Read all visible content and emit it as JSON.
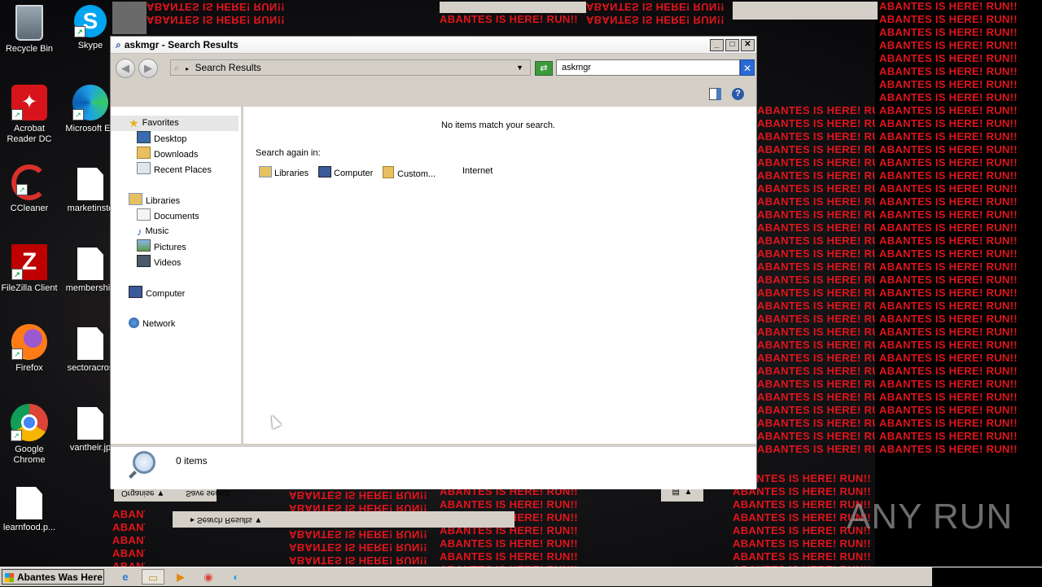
{
  "spam_text": "ABANTES IS HERE! RUN!!",
  "desktop_icons": [
    {
      "label": "Recycle Bin"
    },
    {
      "label": "Skype"
    },
    {
      "label": "Acrobat Reader DC"
    },
    {
      "label": "Microsoft Ed"
    },
    {
      "label": "CCleaner"
    },
    {
      "label": "marketinste"
    },
    {
      "label": "FileZilla Client"
    },
    {
      "label": "membership"
    },
    {
      "label": "Firefox"
    },
    {
      "label": "sectoracros"
    },
    {
      "label": "Google Chrome"
    },
    {
      "label": "vantheir.jp"
    },
    {
      "label": "learnfood.p..."
    }
  ],
  "window": {
    "title": "askmgr - Search Results",
    "address": "Search Results",
    "search_value": "askmgr",
    "nav": {
      "favorites": "Favorites",
      "desktop": "Desktop",
      "downloads": "Downloads",
      "recent": "Recent Places",
      "libraries": "Libraries",
      "documents": "Documents",
      "music": "Music",
      "pictures": "Pictures",
      "videos": "Videos",
      "computer": "Computer",
      "network": "Network"
    },
    "content": {
      "empty_message": "No items match your search.",
      "search_again": "Search again in:",
      "locations": [
        "Libraries",
        "Computer",
        "Custom...",
        "Internet"
      ]
    },
    "status_count": "0 items"
  },
  "ghost": {
    "organise": "Organise",
    "save_search": "Save search",
    "breadcrumb": "Search Results"
  },
  "taskbar": {
    "start_label": "Abantes Was Here"
  },
  "watermark": "ANY RUN"
}
